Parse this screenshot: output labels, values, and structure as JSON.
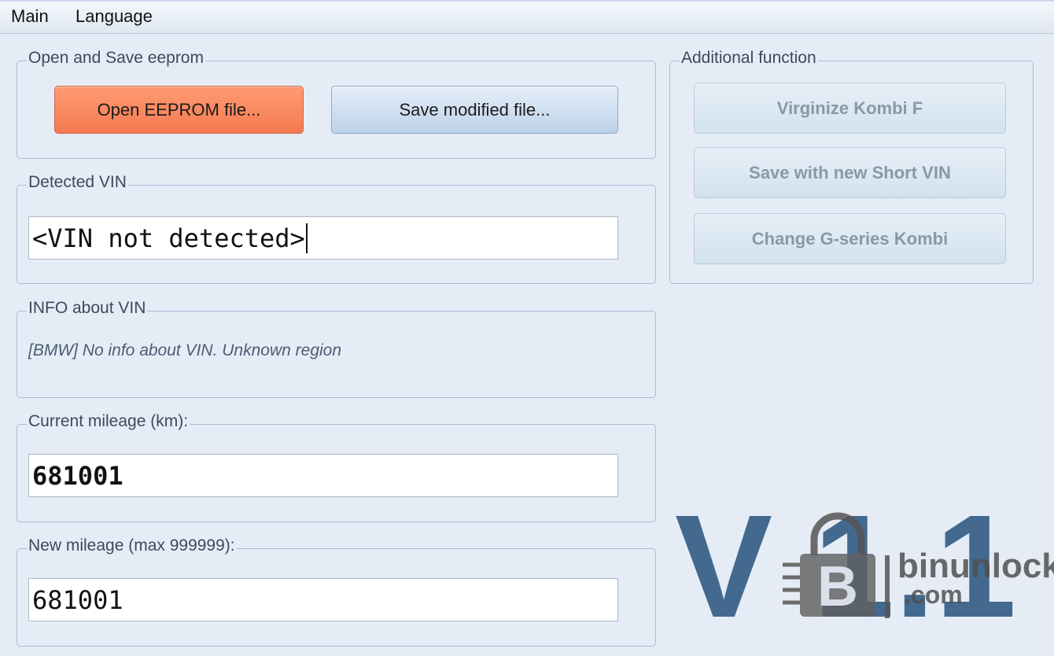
{
  "menu": {
    "items": [
      "Main",
      "Language"
    ]
  },
  "open_save": {
    "title": "Open and Save eeprom",
    "open_label": "Open EEPROM file...",
    "save_label": "Save modified file..."
  },
  "additional": {
    "title": "Additional function",
    "virginize_label": "Virginize Kombi F",
    "short_vin_label": "Save with new Short VIN",
    "g_series_label": "Change G-series Kombi"
  },
  "vin": {
    "title": "Detected VIN",
    "value": "<VIN not detected>"
  },
  "info": {
    "title": "INFO about VIN",
    "text": "[BMW] No info about VIN. Unknown region"
  },
  "current_mileage": {
    "title": "Current mileage (km):",
    "value": "681001"
  },
  "new_mileage": {
    "title": "New mileage (max 999999):",
    "value": "681001"
  },
  "version": {
    "text": "V 1.1"
  },
  "watermark": {
    "line1": "binunlock",
    "line2": ".com"
  },
  "colors": {
    "accent_orange": "#f47a50",
    "version_blue": "#43698f",
    "window_bg": "#e6ecf6"
  }
}
